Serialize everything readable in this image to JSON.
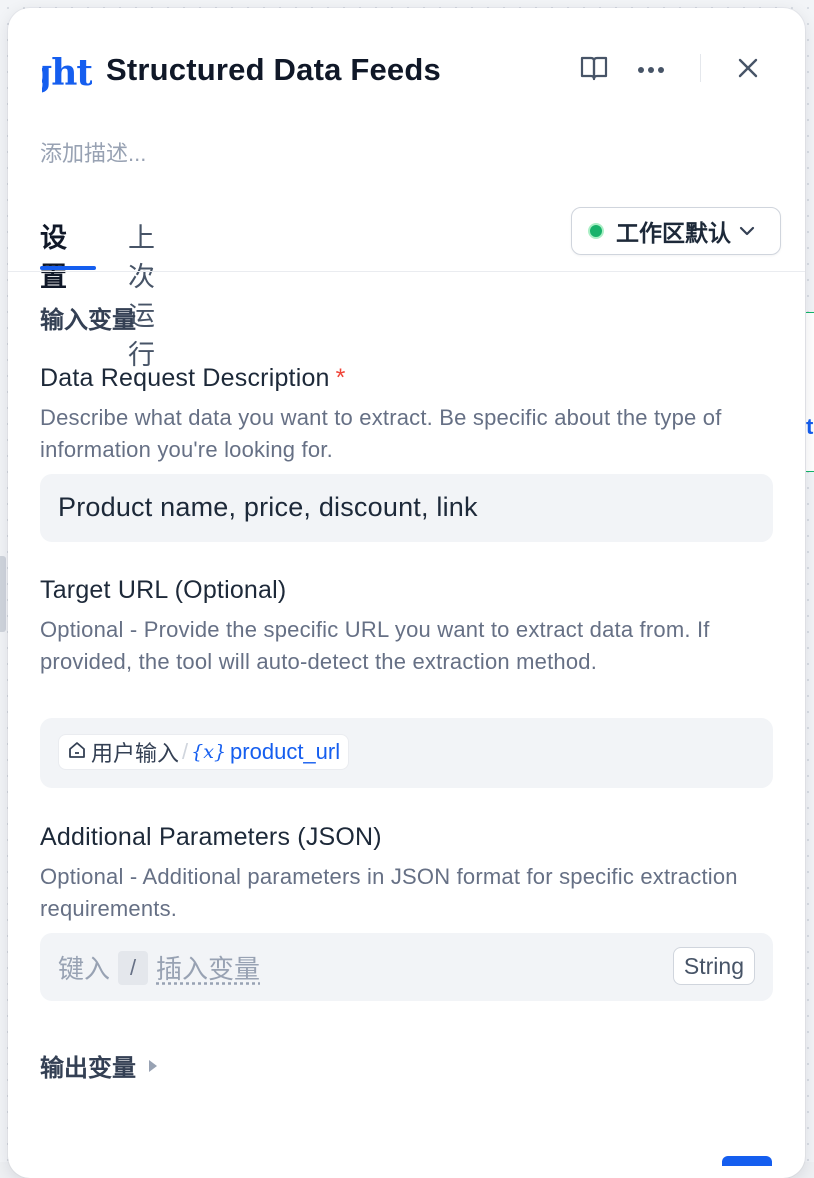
{
  "colors": {
    "accent": "#155eef",
    "status_green": "#17b26a",
    "required": "#f04438"
  },
  "header": {
    "logo_text": "ght",
    "title": "Structured Data Feeds",
    "icons": [
      "book-icon",
      "more-icon",
      "close-icon"
    ]
  },
  "description_placeholder": "添加描述...",
  "tabs": [
    {
      "label": "设置",
      "active": true
    },
    {
      "label": "上次运行",
      "active": false
    }
  ],
  "environment": {
    "label": "工作区默认",
    "status": "green"
  },
  "inputs_section": {
    "title": "输入变量",
    "fields": [
      {
        "label": "Data Request Description",
        "required_mark": "*",
        "help": "Describe what data you want to extract. Be specific about the type of information you're looking for.",
        "value": "Product name, price, discount, link"
      },
      {
        "label": "Target URL (Optional)",
        "help": "Optional - Provide the specific URL you want to extract data from. If provided, the tool will auto-detect the extraction method.",
        "variable": {
          "source_icon": "home-icon",
          "source": "用户输入",
          "separator": "/",
          "var_symbol": "{x}",
          "name": "product_url"
        }
      },
      {
        "label": "Additional Parameters (JSON)",
        "help": "Optional - Additional parameters in JSON format for specific extraction requirements.",
        "placeholder_prefix": "键入",
        "placeholder_key": "/",
        "placeholder_suffix": "插入变量",
        "type_badge": "String"
      }
    ]
  },
  "outputs_section": {
    "title": "输出变量"
  }
}
